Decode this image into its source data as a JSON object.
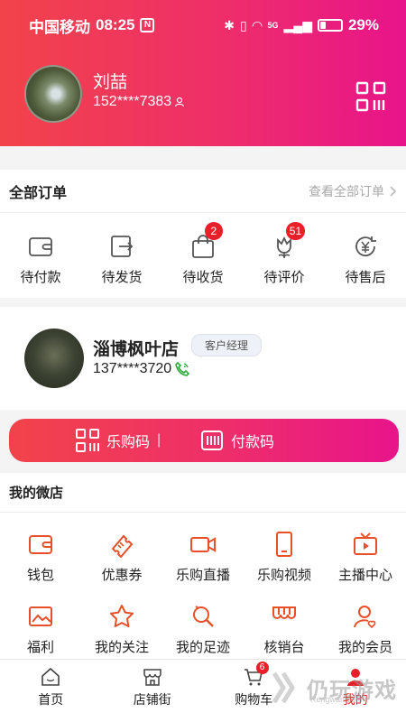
{
  "colors": {
    "brand_start": "#f2434a",
    "brand_end": "#e8148a",
    "accent": "#e8202a",
    "icon": "#e8502a"
  },
  "status_bar": {
    "carrier": "中国移动",
    "time": "08:25",
    "nfc": "N",
    "network": "5G",
    "battery": "29%",
    "battery_level": 0.29
  },
  "profile": {
    "name": "刘喆",
    "phone": "152****7383",
    "avatar_icon": "user-avatar",
    "qr_icon": "qrcode-icon"
  },
  "orders": {
    "title": "全部订单",
    "view_all": "查看全部订单",
    "items": [
      {
        "label": "待付款",
        "icon": "wallet-icon",
        "badge": ""
      },
      {
        "label": "待发货",
        "icon": "ship-icon",
        "badge": ""
      },
      {
        "label": "待收货",
        "icon": "bag-icon",
        "badge": "2"
      },
      {
        "label": "待评价",
        "icon": "flower-icon",
        "badge": "51"
      },
      {
        "label": "待售后",
        "icon": "after-sale-icon",
        "badge": ""
      }
    ]
  },
  "shop": {
    "name": "淄博枫叶店",
    "tag": "客户经理",
    "phone": "137****3720"
  },
  "pay_bar": {
    "left_label": "乐购码",
    "right_label": "付款码"
  },
  "micro_shop": {
    "title": "我的微店",
    "items": [
      {
        "label": "钱包",
        "icon": "wallet-icon"
      },
      {
        "label": "优惠券",
        "icon": "ticket-icon"
      },
      {
        "label": "乐购直播",
        "icon": "video-camera-icon"
      },
      {
        "label": "乐购视频",
        "icon": "phone-icon"
      },
      {
        "label": "主播中心",
        "icon": "tv-icon"
      },
      {
        "label": "福利",
        "icon": "picture-icon"
      },
      {
        "label": "我的关注",
        "icon": "star-icon"
      },
      {
        "label": "我的足迹",
        "icon": "footprint-icon"
      },
      {
        "label": "核销台",
        "icon": "store-icon"
      },
      {
        "label": "我的会员",
        "icon": "member-icon"
      }
    ]
  },
  "tabbar": {
    "items": [
      {
        "label": "首页",
        "icon": "home-icon",
        "active": false
      },
      {
        "label": "店铺街",
        "icon": "shop-street-icon",
        "active": false
      },
      {
        "label": "购物车",
        "icon": "cart-icon",
        "active": false,
        "badge": "6"
      },
      {
        "label": "我的",
        "icon": "user-icon",
        "active": true
      }
    ]
  },
  "watermark": {
    "title": "仍玩游戏",
    "subtitle": "Rengwan.com"
  }
}
